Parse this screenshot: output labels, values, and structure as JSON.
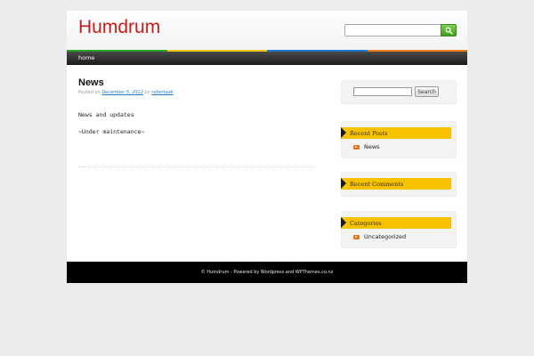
{
  "header": {
    "site_title": "Humdrum",
    "search_placeholder": "",
    "search_icon": "magnifier-icon",
    "accent_colors": [
      "#27a52b",
      "#f2c413",
      "#1d7ad1",
      "#ee7f1b"
    ]
  },
  "nav": {
    "items": [
      {
        "label": "home"
      }
    ]
  },
  "post": {
    "title": "News",
    "meta_prefix": "Posted on",
    "date": "December 5, 2012",
    "by": "by",
    "author": "robertaak",
    "body": [
      "News and updates",
      "~Under maintenance~"
    ]
  },
  "sidebar": {
    "search_button": "Search",
    "search_value": "",
    "recent_posts": {
      "title": "Recent Posts",
      "items": [
        "News"
      ]
    },
    "recent_comments": {
      "title": "Recent Comments"
    },
    "categories": {
      "title": "Categories",
      "items": [
        "Uncategorized"
      ]
    }
  },
  "footer": {
    "text": "© Humdrum - Powered by Wordpress and WPThemes.co.nz"
  }
}
